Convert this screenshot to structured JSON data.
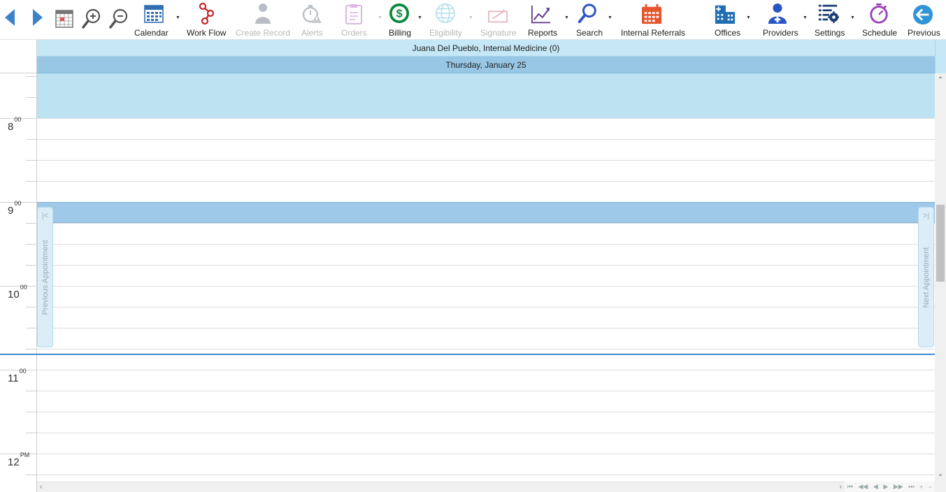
{
  "toolbar": {
    "calendar": "Calendar",
    "work_flow": "Work Flow",
    "create_record": "Create Record",
    "alerts": "Alerts",
    "orders": "Orders",
    "billing": "Billing",
    "eligibility": "Eligibility",
    "signature": "Signature",
    "reports": "Reports",
    "search": "Search",
    "internal_referrals": "Internal Referrals",
    "offices": "Offices",
    "providers": "Providers",
    "settings": "Settings",
    "schedule": "Schedule",
    "previous": "Previous"
  },
  "scheduler": {
    "resource": "Juana Del Pueblo, Internal Medicine (0)",
    "date": "Thursday, January 25",
    "hours": [
      {
        "hour": "8",
        "suffix": "00"
      },
      {
        "hour": "9",
        "suffix": "00"
      },
      {
        "hour": "10",
        "suffix": "00"
      },
      {
        "hour": "11",
        "suffix": "00"
      },
      {
        "hour": "12",
        "suffix": "PM"
      }
    ],
    "previous_appointment": "Previous Appointment",
    "next_appointment": "Next Appointment"
  },
  "icons": {
    "back": "triangle-left-icon",
    "forward": "triangle-right-icon",
    "day_view": "calendar-day-icon",
    "zoom_in": "zoom-in-icon",
    "zoom_out": "zoom-out-icon"
  },
  "colors": {
    "resource_header": "#c6e7f6",
    "date_header": "#98c7e6",
    "current_time": "#3f87d0",
    "nav_blue": "#3d82c9"
  }
}
